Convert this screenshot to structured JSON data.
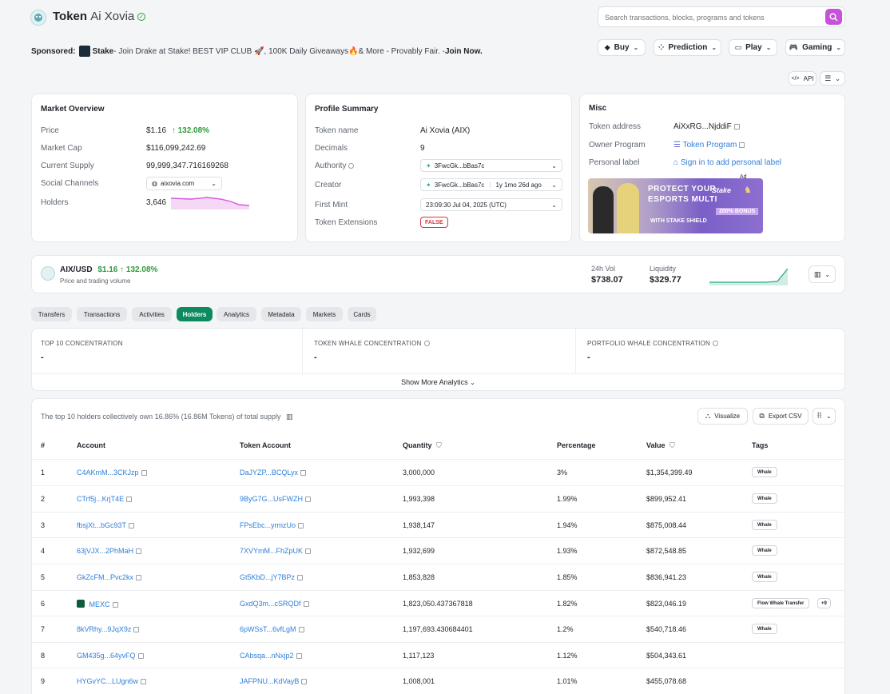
{
  "header": {
    "title_prefix": "Token",
    "title_name": "Ai Xovia",
    "search_placeholder": "Search transactions, blocks, programs and tokens"
  },
  "sponsor": {
    "label": "Sponsored:",
    "brand": "Stake",
    "text": " - Join Drake at Stake! BEST VIP CLUB 🚀, 100K Daily Giveaways🔥& More - Provably Fair. - ",
    "cta": "Join Now."
  },
  "nav": {
    "buy": "Buy",
    "prediction": "Prediction",
    "play": "Play",
    "gaming": "Gaming",
    "api": "API"
  },
  "market": {
    "title": "Market Overview",
    "price_label": "Price",
    "price": "$1.16",
    "price_change": "↑ 132.08%",
    "cap_label": "Market Cap",
    "cap": "$116,099,242.69",
    "supply_label": "Current Supply",
    "supply": "99,999,347.716169268",
    "social_label": "Social Channels",
    "social": "aixovia.com",
    "holders_label": "Holders",
    "holders": "3,646"
  },
  "profile": {
    "title": "Profile Summary",
    "name_label": "Token name",
    "name": "Ai Xovia (AIX)",
    "decimals_label": "Decimals",
    "decimals": "9",
    "authority_label": "Authority",
    "authority": "3FwcGk...bBas7c",
    "creator_label": "Creator",
    "creator": "3FwcGk...bBas7c",
    "creator_age": "1y 1mo 26d ago",
    "first_mint_label": "First Mint",
    "first_mint": "23:09:30 Jul 04, 2025 (UTC)",
    "extensions_label": "Token Extensions",
    "extensions": "FALSE"
  },
  "misc": {
    "title": "Misc",
    "address_label": "Token address",
    "address": "AiXxRG...NjddiF",
    "owner_label": "Owner Program",
    "owner": "Token Program",
    "personal_label": "Personal label",
    "personal": "Sign in to add personal label",
    "ad_label": "Ad",
    "ad_line1": "PROTECT YOUR",
    "ad_line2": "ESPORTS MULTI",
    "ad_line3": "WITH STAKE SHIELD",
    "ad_bonus": "200% BONUS",
    "ad_brand": "Stake"
  },
  "pair": {
    "name": "AIX/USD",
    "price": "$1.16",
    "change": "↑ 132.08%",
    "subtitle": "Price and trading volume",
    "vol_label": "24h Vol",
    "vol": "$738.07",
    "liq_label": "Liquidity",
    "liq": "$329.77"
  },
  "tabs": [
    "Transfers",
    "Transactions",
    "Activities",
    "Holders",
    "Analytics",
    "Metadata",
    "Markets",
    "Cards"
  ],
  "concentration": {
    "top10_label": "TOP 10 CONCENTRATION",
    "top10": "-",
    "token_whale_label": "TOKEN WHALE CONCENTRATION",
    "token_whale": "-",
    "portfolio_whale_label": "PORTFOLIO WHALE CONCENTRATION",
    "portfolio_whale": "-",
    "show_more": "Show More Analytics"
  },
  "holders": {
    "summary": "The top 10 holders collectively own 16.86% (16.86M Tokens) of total supply",
    "visualize": "Visualize",
    "export": "Export CSV",
    "columns": [
      "#",
      "Account",
      "Token Account",
      "Quantity",
      "Percentage",
      "Value",
      "Tags"
    ],
    "rows": [
      {
        "n": "1",
        "account": "C4AKmM...3CKJzp",
        "token_account": "DaJYZP...BCQLyx",
        "qty": "3,000,000",
        "pct": "3%",
        "value": "$1,354,399.49",
        "tag": "Whale"
      },
      {
        "n": "2",
        "account": "CTrf5j...KrjT4E",
        "token_account": "9ByG7G...UsFWZH",
        "qty": "1,993,398",
        "pct": "1.99%",
        "value": "$899,952.41",
        "tag": "Whale"
      },
      {
        "n": "3",
        "account": "fbsjXt...bGc93T",
        "token_account": "FPsEbc...yrmzUo",
        "qty": "1,938,147",
        "pct": "1.94%",
        "value": "$875,008.44",
        "tag": "Whale"
      },
      {
        "n": "4",
        "account": "63jVJX...2PhMaH",
        "token_account": "7XVYmM...FhZpUK",
        "qty": "1,932,699",
        "pct": "1.93%",
        "value": "$872,548.85",
        "tag": "Whale"
      },
      {
        "n": "5",
        "account": "GkZcFM...Pvc2kx",
        "token_account": "Gt5KbD...jY7BPz",
        "qty": "1,853,828",
        "pct": "1.85%",
        "value": "$836,941.23",
        "tag": "Whale"
      },
      {
        "n": "6",
        "account": "MEXC",
        "token_account": "GxdQ3m...cSRQDf",
        "qty": "1,823,050.437367818",
        "pct": "1.82%",
        "value": "$823,046.19",
        "tag": "Flow Whale Transfer",
        "extra": "+9"
      },
      {
        "n": "7",
        "account": "8kVRhy...9JqX9z",
        "token_account": "6pWSsT...6vfLgM",
        "qty": "1,197,693.430684401",
        "pct": "1.2%",
        "value": "$540,718.46",
        "tag": "Whale"
      },
      {
        "n": "8",
        "account": "GM435g...64yvFQ",
        "token_account": "CAbsqa...nNxjp2",
        "qty": "1,117,123",
        "pct": "1.12%",
        "value": "$504,343.61",
        "tag": ""
      },
      {
        "n": "9",
        "account": "HYGvYC...LUgn6w",
        "token_account": "JAFPNU...KdVayB",
        "qty": "1,008,001",
        "pct": "1.01%",
        "value": "$455,078.68",
        "tag": ""
      }
    ]
  },
  "colors": {
    "accent": "#0d8a5f",
    "search_button": "#c552d9",
    "link": "#2f7fd9",
    "positive": "#2e9b3a",
    "holders_spark": "#d55ad8",
    "liquidity_spark": "#2aa88a"
  }
}
